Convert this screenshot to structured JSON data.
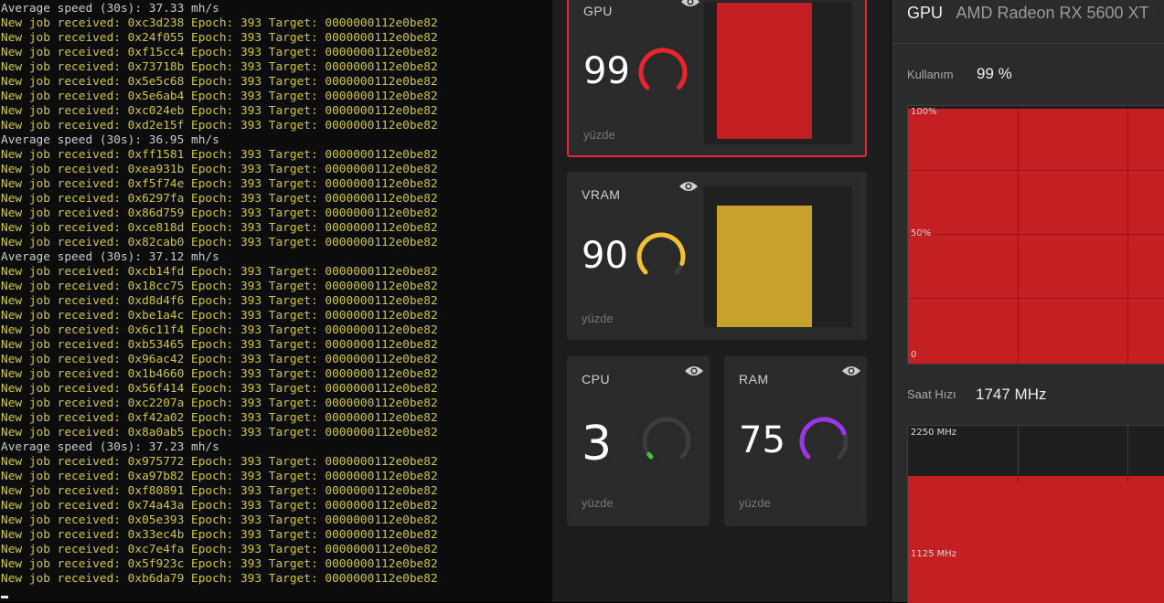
{
  "terminal": {
    "lines": [
      {
        "type": "speed",
        "text": "Average speed (30s): 37.33 mh/s"
      },
      {
        "type": "job",
        "text": "New job received: 0xc3d238 Epoch: 393 Target: 0000000112e0be82"
      },
      {
        "type": "job",
        "text": "New job received: 0x24f055 Epoch: 393 Target: 0000000112e0be82"
      },
      {
        "type": "job",
        "text": "New job received: 0xf15cc4 Epoch: 393 Target: 0000000112e0be82"
      },
      {
        "type": "job",
        "text": "New job received: 0x73718b Epoch: 393 Target: 0000000112e0be82"
      },
      {
        "type": "job",
        "text": "New job received: 0x5e5c68 Epoch: 393 Target: 0000000112e0be82"
      },
      {
        "type": "job",
        "text": "New job received: 0x5e6ab4 Epoch: 393 Target: 0000000112e0be82"
      },
      {
        "type": "job",
        "text": "New job received: 0xc024eb Epoch: 393 Target: 0000000112e0be82"
      },
      {
        "type": "job",
        "text": "New job received: 0xd2e15f Epoch: 393 Target: 0000000112e0be82"
      },
      {
        "type": "speed",
        "text": "Average speed (30s): 36.95 mh/s"
      },
      {
        "type": "job",
        "text": "New job received: 0xff1581 Epoch: 393 Target: 0000000112e0be82"
      },
      {
        "type": "job",
        "text": "New job received: 0xea931b Epoch: 393 Target: 0000000112e0be82"
      },
      {
        "type": "job",
        "text": "New job received: 0xf5f74e Epoch: 393 Target: 0000000112e0be82"
      },
      {
        "type": "job",
        "text": "New job received: 0x6297fa Epoch: 393 Target: 0000000112e0be82"
      },
      {
        "type": "job",
        "text": "New job received: 0x86d759 Epoch: 393 Target: 0000000112e0be82"
      },
      {
        "type": "job",
        "text": "New job received: 0xce818d Epoch: 393 Target: 0000000112e0be82"
      },
      {
        "type": "job",
        "text": "New job received: 0x82cab0 Epoch: 393 Target: 0000000112e0be82"
      },
      {
        "type": "speed",
        "text": "Average speed (30s): 37.12 mh/s"
      },
      {
        "type": "job",
        "text": "New job received: 0xcb14fd Epoch: 393 Target: 0000000112e0be82"
      },
      {
        "type": "job",
        "text": "New job received: 0x18cc75 Epoch: 393 Target: 0000000112e0be82"
      },
      {
        "type": "job",
        "text": "New job received: 0xd8d4f6 Epoch: 393 Target: 0000000112e0be82"
      },
      {
        "type": "job",
        "text": "New job received: 0xbe1a4c Epoch: 393 Target: 0000000112e0be82"
      },
      {
        "type": "job",
        "text": "New job received: 0x6c11f4 Epoch: 393 Target: 0000000112e0be82"
      },
      {
        "type": "job",
        "text": "New job received: 0xb53465 Epoch: 393 Target: 0000000112e0be82"
      },
      {
        "type": "job",
        "text": "New job received: 0x96ac42 Epoch: 393 Target: 0000000112e0be82"
      },
      {
        "type": "job",
        "text": "New job received: 0x1b4660 Epoch: 393 Target: 0000000112e0be82"
      },
      {
        "type": "job",
        "text": "New job received: 0x56f414 Epoch: 393 Target: 0000000112e0be82"
      },
      {
        "type": "job",
        "text": "New job received: 0xc2207a Epoch: 393 Target: 0000000112e0be82"
      },
      {
        "type": "job",
        "text": "New job received: 0xf42a02 Epoch: 393 Target: 0000000112e0be82"
      },
      {
        "type": "job",
        "text": "New job received: 0x8a0ab5 Epoch: 393 Target: 0000000112e0be82"
      },
      {
        "type": "speed",
        "text": "Average speed (30s): 37.23 mh/s"
      },
      {
        "type": "job",
        "text": "New job received: 0x975772 Epoch: 393 Target: 0000000112e0be82"
      },
      {
        "type": "job",
        "text": "New job received: 0xa97b82 Epoch: 393 Target: 0000000112e0be82"
      },
      {
        "type": "job",
        "text": "New job received: 0xf80891 Epoch: 393 Target: 0000000112e0be82"
      },
      {
        "type": "job",
        "text": "New job received: 0x74a43a Epoch: 393 Target: 0000000112e0be82"
      },
      {
        "type": "job",
        "text": "New job received: 0x05e393 Epoch: 393 Target: 0000000112e0be82"
      },
      {
        "type": "job",
        "text": "New job received: 0x33ec4b Epoch: 393 Target: 0000000112e0be82"
      },
      {
        "type": "job",
        "text": "New job received: 0xc7e4fa Epoch: 393 Target: 0000000112e0be82"
      },
      {
        "type": "job",
        "text": "New job received: 0x5f923c Epoch: 393 Target: 0000000112e0be82"
      },
      {
        "type": "job",
        "text": "New job received: 0xb6da79 Epoch: 393 Target: 0000000112e0be82"
      }
    ],
    "colors": {
      "job": "#d1c63f",
      "speed": "#cccccc",
      "background": "#0c0c0c"
    }
  },
  "widgets": {
    "gpu": {
      "title": "GPU",
      "value": "99",
      "unit": "yüzde",
      "gauge_color": "#e8252a",
      "icon": "eye-icon",
      "selected": true,
      "graph_fill": "#c41f22",
      "graph_level": 0.99
    },
    "vram": {
      "title": "VRAM",
      "value": "90",
      "unit": "yüzde",
      "gauge_color": "#f2c230",
      "icon": "eye-icon",
      "graph_fill": "#c9a22e",
      "graph_level": 0.9
    },
    "cpu": {
      "title": "CPU",
      "value": "3",
      "unit": "yüzde",
      "gauge_color": "#44c23a",
      "icon": "eye-icon"
    },
    "ram": {
      "title": "RAM",
      "value": "75",
      "unit": "yüzde",
      "gauge_color": "#9b35e6",
      "icon": "eye-icon"
    },
    "selected_border": "#e8233a"
  },
  "gpu_detail": {
    "header_label": "GPU",
    "device_name": "AMD Radeon RX 5600 XT",
    "usage": {
      "label": "Kullanım",
      "value": "99 %",
      "ticks": [
        "100%",
        "50%",
        "0"
      ],
      "level": 0.99,
      "fill": "#c41f22"
    },
    "clock": {
      "label": "Saat Hızı",
      "value": "1747 MHz",
      "ticks": [
        "2250 MHz",
        "1125 MHz"
      ],
      "level_mhz": 1747,
      "max_mhz": 2250,
      "fill": "#c41f22"
    }
  }
}
